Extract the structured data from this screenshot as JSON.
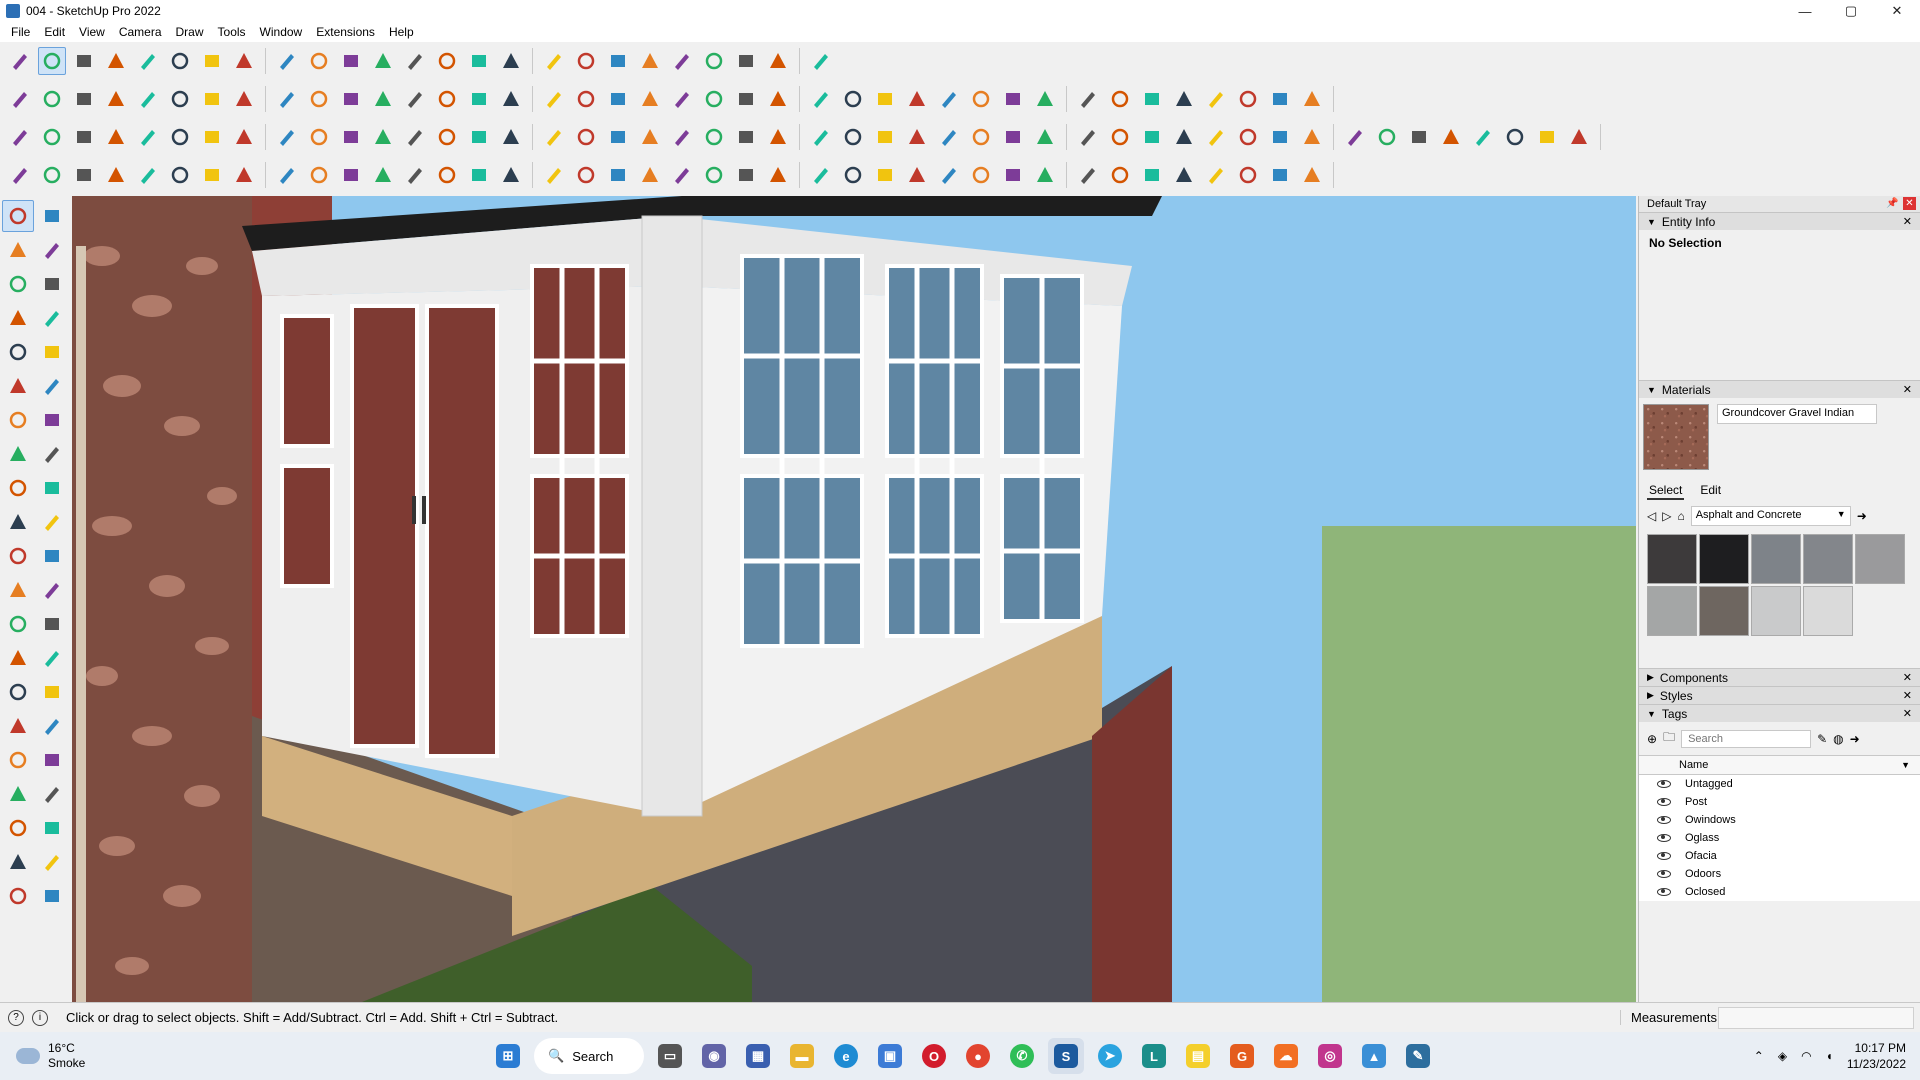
{
  "window": {
    "title": "004 - SketchUp Pro 2022",
    "minimize": "—",
    "maximize": "▢",
    "close": "✕"
  },
  "menu": [
    "File",
    "Edit",
    "View",
    "Camera",
    "Draw",
    "Tools",
    "Window",
    "Extensions",
    "Help"
  ],
  "toolbars": {
    "row1": [
      "zoom-icon",
      "select-icon",
      "eraser-icon",
      "pencil-icon",
      "lasso-icon",
      "paint-icon",
      "push-pull-icon",
      "follow-me-icon",
      "move-icon",
      "rotate-icon",
      "scale-icon",
      "tape-icon",
      "text-icon",
      "paint-bucket-icon",
      "orbit-icon",
      "pan-icon",
      "zoom-window-icon",
      "zoom-extents-icon",
      "iso-view-icon",
      "top-view-icon",
      "front-view-icon",
      "right-view-icon",
      "back-view-icon",
      "left-view-icon",
      "bottom-view-icon"
    ],
    "row2_count": 40,
    "row3_count": 48,
    "row4_count": 40
  },
  "tray": {
    "title": "Default Tray",
    "entity_info": {
      "header": "Entity Info",
      "value": "No Selection"
    },
    "materials": {
      "header": "Materials",
      "current_name": "Groundcover Gravel Indian",
      "tab_select": "Select",
      "tab_edit": "Edit",
      "library": "Asphalt and Concrete",
      "swatch_colors": [
        "#3d3a3b",
        "#1e1e20",
        "#7e8389",
        "#83868b",
        "#9a9a9c",
        "#a4a6a6",
        "#6e6660",
        "#c9cacb",
        "#dadada"
      ]
    },
    "components": {
      "header": "Components"
    },
    "styles": {
      "header": "Styles"
    },
    "tags": {
      "header": "Tags",
      "search_placeholder": "Search",
      "column_name": "Name",
      "items": [
        "Untagged",
        "Post",
        "Owindows",
        "Oglass",
        "Ofacia",
        "Odoors",
        "Oclosed"
      ]
    }
  },
  "status": {
    "message": "Click or drag to select objects. Shift = Add/Subtract. Ctrl = Add. Shift + Ctrl = Subtract.",
    "measurements_label": "Measurements"
  },
  "taskbar": {
    "weather_temp": "16°C",
    "weather_desc": "Smoke",
    "search_label": "Search",
    "time": "10:17 PM",
    "date": "11/23/2022"
  }
}
